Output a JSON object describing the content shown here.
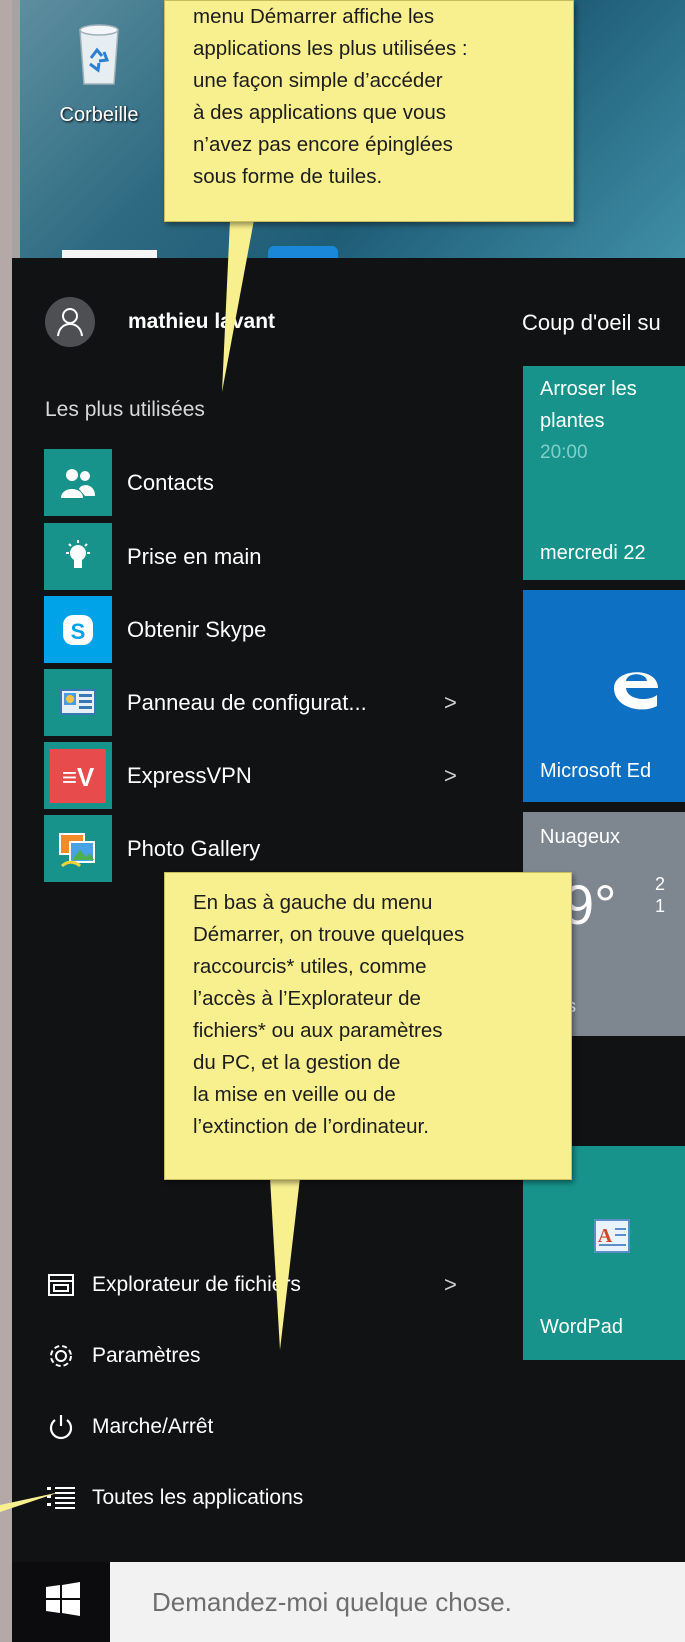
{
  "desktop": {
    "recycle_bin_label": "Corbeille"
  },
  "start_menu": {
    "user_name": "mathieu lavant",
    "most_used_title": "Les plus utilisées",
    "apps": [
      {
        "label": "Contacts",
        "icon": "contacts-icon",
        "color": "#17938c"
      },
      {
        "label": "Prise en main",
        "icon": "lightbulb-icon",
        "color": "#17938c"
      },
      {
        "label": "Obtenir Skype",
        "icon": "skype-icon",
        "color": "#00a3e8"
      },
      {
        "label": "Panneau de configurat...",
        "icon": "control-panel-icon",
        "color": "#17938c"
      },
      {
        "label": "ExpressVPN",
        "icon": "expressvpn-icon",
        "color": "#e84b4b"
      },
      {
        "label": "Photo Gallery",
        "icon": "photo-gallery-icon",
        "color": "#17938c"
      }
    ],
    "system_items": [
      {
        "label": "Explorateur de fichiers",
        "icon": "file-explorer-icon"
      },
      {
        "label": "Paramètres",
        "icon": "gear-icon"
      },
      {
        "label": "Marche/Arrêt",
        "icon": "power-icon"
      },
      {
        "label": "Toutes les applications",
        "icon": "all-apps-list-icon"
      }
    ],
    "chevron": ">",
    "search_placeholder": "Demandez-moi quelque chose."
  },
  "tiles": {
    "group_title": "Coup d'oeil su",
    "calendar": {
      "line1": "Arroser les",
      "line2": "plantes",
      "time": "20:00",
      "day": "mercredi 22",
      "time_color": "#7fd0c8"
    },
    "edge": {
      "label": "Microsoft Ed"
    },
    "weather": {
      "condition": "Nuageux",
      "temp": "9°",
      "hi": "2",
      "lo": "1",
      "city": "is"
    },
    "wordpad": {
      "label": "WordPad"
    }
  },
  "callouts": {
    "top": [
      "menu  Démarrer affiche les",
      "applications les plus utilisées :",
      "une façon simple d’accéder",
      "à des applications que vous",
      "n’avez pas encore épinglées",
      "sous forme de tuiles."
    ],
    "bottom": [
      "En bas à gauche du menu",
      "Démarrer, on trouve quelques",
      "raccourcis* utiles, comme",
      "l’accès à l’Explorateur de",
      "fichiers* ou aux paramètres",
      "du PC, et la gestion de",
      "la mise en veille ou de",
      "l’extinction de l’ordinateur."
    ]
  }
}
